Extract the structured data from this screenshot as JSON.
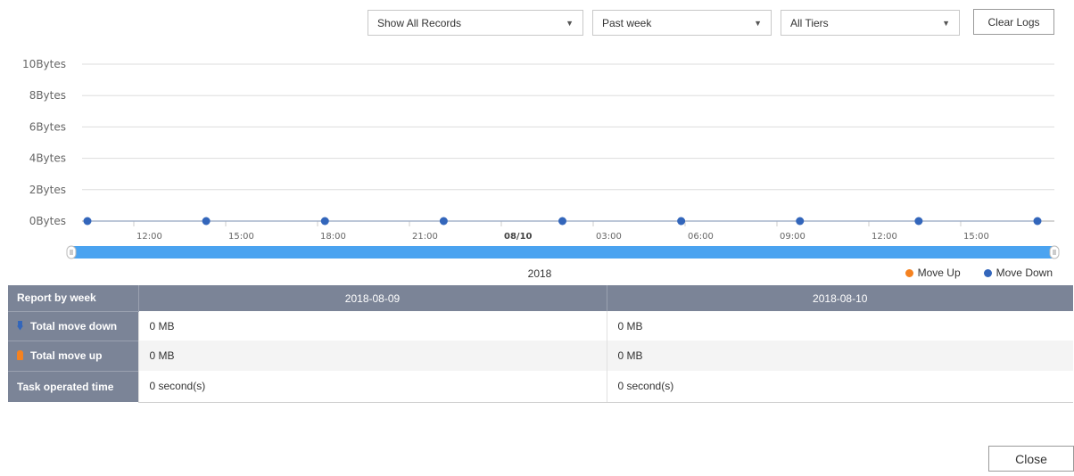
{
  "toolbar": {
    "record_filter": "Show All Records",
    "time_range": "Past week",
    "tier_filter": "All Tiers",
    "clear_logs_label": "Clear Logs"
  },
  "colors": {
    "move_up": "#f58220",
    "move_down": "#3366bb",
    "slider": "#4aa3f0",
    "header": "#7b8497"
  },
  "chart_data": {
    "type": "line",
    "y_tick_labels": [
      "10Bytes",
      "8Bytes",
      "6Bytes",
      "4Bytes",
      "2Bytes",
      "0Bytes"
    ],
    "ylim": [
      0,
      10
    ],
    "x_tick_labels": [
      "12:00",
      "15:00",
      "18:00",
      "21:00",
      "08/10",
      "03:00",
      "06:00",
      "09:00",
      "12:00",
      "15:00"
    ],
    "x_label_bold": "08/10",
    "xlabel": "2018",
    "legend": [
      "Move Up",
      "Move Down"
    ],
    "legend_position": "bottom-right",
    "grid": true,
    "series": [
      {
        "name": "Move Down",
        "values": [
          0,
          0,
          0,
          0,
          0,
          0,
          0,
          0,
          0
        ]
      }
    ]
  },
  "report": {
    "header_label": "Report by week",
    "dates": [
      "2018-08-09",
      "2018-08-10"
    ],
    "rows": [
      {
        "label": "Total move down",
        "icon": "arrow-down-icon",
        "values": [
          "0 MB",
          "0 MB"
        ]
      },
      {
        "label": "Total move up",
        "icon": "arrow-up-icon",
        "values": [
          "0 MB",
          "0 MB"
        ]
      },
      {
        "label": "Task operated time",
        "icon": "",
        "values": [
          "0 second(s)",
          "0 second(s)"
        ]
      }
    ]
  },
  "footer": {
    "close_label": "Close"
  }
}
